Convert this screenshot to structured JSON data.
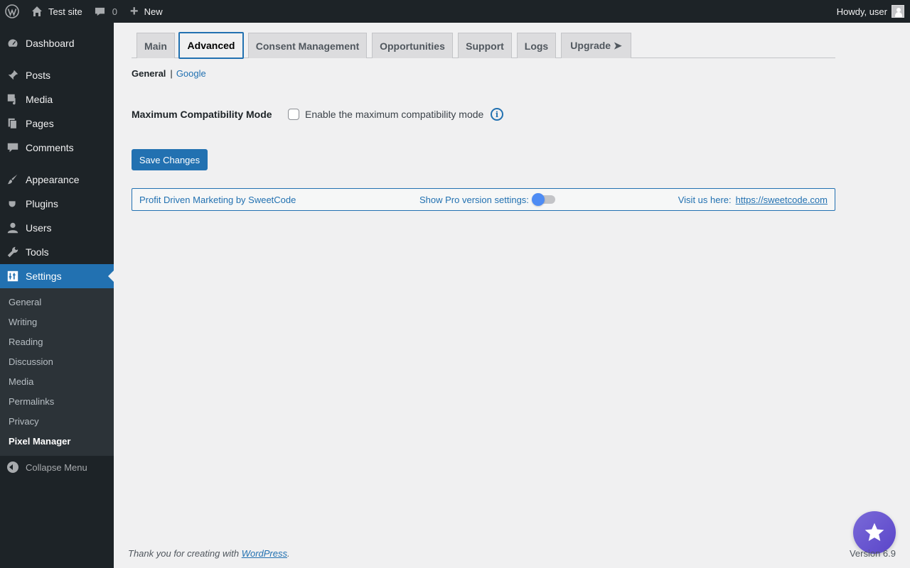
{
  "adminbar": {
    "site_name": "Test site",
    "comments_count": "0",
    "new_label": "New",
    "howdy": "Howdy, user"
  },
  "menu": {
    "items": [
      {
        "label": "Dashboard",
        "icon": "dashboard-icon"
      },
      {
        "label": "Posts",
        "icon": "pin-icon"
      },
      {
        "label": "Media",
        "icon": "media-icon"
      },
      {
        "label": "Pages",
        "icon": "pages-icon"
      },
      {
        "label": "Comments",
        "icon": "comment-icon"
      },
      {
        "label": "Appearance",
        "icon": "brush-icon"
      },
      {
        "label": "Plugins",
        "icon": "plugin-icon"
      },
      {
        "label": "Users",
        "icon": "users-icon"
      },
      {
        "label": "Tools",
        "icon": "wrench-icon"
      },
      {
        "label": "Settings",
        "icon": "settings-icon"
      }
    ],
    "submenu": [
      "General",
      "Writing",
      "Reading",
      "Discussion",
      "Media",
      "Permalinks",
      "Privacy",
      "Pixel Manager"
    ],
    "collapse": "Collapse Menu"
  },
  "tabs": [
    "Main",
    "Advanced",
    "Consent Management",
    "Opportunities",
    "Support",
    "Logs",
    "Upgrade ➤"
  ],
  "subnav": {
    "current": "General",
    "separator": "|",
    "link": "Google"
  },
  "form": {
    "label": "Maximum Compatibility Mode",
    "checkbox_label": "Enable the maximum compatibility mode",
    "checked": false,
    "info_glyph": "i"
  },
  "save_button": "Save Changes",
  "footer_box": {
    "brand": "Profit Driven Marketing by SweetCode",
    "pro_toggle_label": "Show Pro version settings:",
    "pro_toggle_on": false,
    "visit_label": "Visit us here:",
    "visit_link": "https://sweetcode.com"
  },
  "wp_footer": {
    "thanks_prefix": "Thank you for creating with ",
    "wp_link": "WordPress",
    "thanks_suffix": ".",
    "version": "Version 6.9"
  },
  "colors": {
    "accent": "#2271b1",
    "adminbar": "#1d2327",
    "fab": "#6a56d1"
  }
}
